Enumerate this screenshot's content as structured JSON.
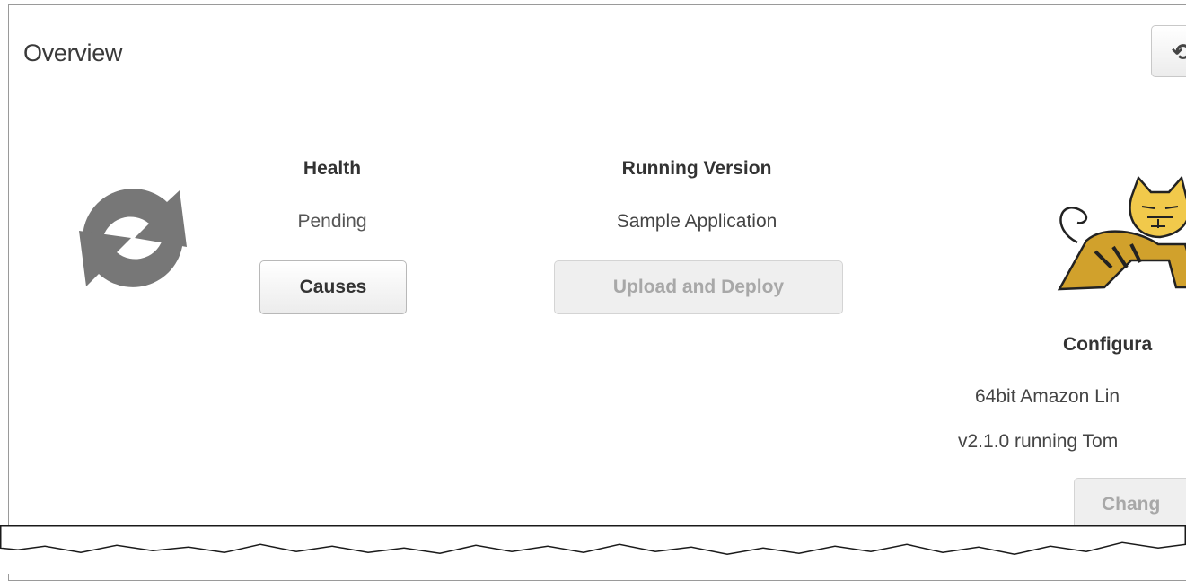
{
  "header": {
    "title": "Overview",
    "refresh_icon": "refresh-icon"
  },
  "status": {
    "icon": "sync-icon"
  },
  "health": {
    "label": "Health",
    "value": "Pending",
    "button": "Causes"
  },
  "version": {
    "label": "Running Version",
    "value": "Sample Application",
    "button": "Upload and Deploy"
  },
  "configuration": {
    "label": "Configura",
    "line1": "64bit Amazon Lin",
    "line2": "v2.1.0 running Tom",
    "button": "Chang",
    "logo_icon": "tomcat-logo-icon"
  },
  "colors": {
    "pending": "#555555",
    "icon": "#777777",
    "logo_gold": "#d1a12c"
  }
}
